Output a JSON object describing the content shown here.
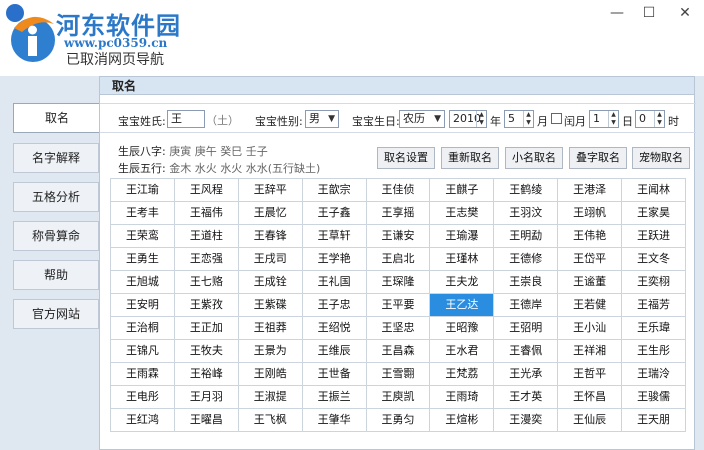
{
  "window": {
    "title": "",
    "minimize": "—",
    "maximize": "☐",
    "close": "✕"
  },
  "watermark": {
    "title": "河东软件园",
    "url": "www.pc0359.cn"
  },
  "status": "已取消网页导航",
  "sidebar": {
    "items": [
      "取名",
      "名字解释",
      "五格分析",
      "称骨算命",
      "帮助",
      "官方网站"
    ]
  },
  "panel": {
    "title": "取名"
  },
  "form": {
    "surname_label": "宝宝姓氏:",
    "surname_value": "王",
    "surname_element": "（土）",
    "gender_label": "宝宝性别:",
    "gender_value": "男",
    "birth_label": "宝宝生日:",
    "calendar_value": "农历",
    "year": "2010",
    "year_unit": "年",
    "month": "5",
    "month_unit": "月",
    "leap_label": "闰月",
    "day": "1",
    "day_unit": "日",
    "hour": "0",
    "hour_unit": "时"
  },
  "bazi": {
    "label": "生辰八字:",
    "value": "庚寅  庚午  癸巳  壬子",
    "wuxing_label": "生辰五行:",
    "wuxing_value": "金木  水火  水火  水水(五行缺土)"
  },
  "actions": [
    "取名设置",
    "重新取名",
    "小名取名",
    "叠字取名",
    "宠物取名"
  ],
  "names": [
    [
      "王江瑜",
      "王风程",
      "王辞平",
      "王歆宗",
      "王佳侦",
      "王麒子",
      "王鹤绫",
      "王港泽",
      "王闻林"
    ],
    [
      "王考丰",
      "王福伟",
      "王晨忆",
      "王子鑫",
      "王享摇",
      "王志樊",
      "王羽汶",
      "王翊帆",
      "王家昊"
    ],
    [
      "王荣鸾",
      "王道柱",
      "王春锋",
      "王草轩",
      "王谦安",
      "王瑜瀑",
      "王明勐",
      "王伟艳",
      "王跃进"
    ],
    [
      "王勇生",
      "王恋强",
      "王戌司",
      "王学艳",
      "王启北",
      "王瑾林",
      "王德修",
      "王岱平",
      "王文冬"
    ],
    [
      "王旭城",
      "王七赂",
      "王成铨",
      "王礼国",
      "王琛隆",
      "王夫龙",
      "王崇良",
      "王谧董",
      "王奕栩"
    ],
    [
      "王安明",
      "王紫孜",
      "王紫碟",
      "王子忠",
      "王平要",
      "王乙达",
      "王德岸",
      "王若健",
      "王福芳"
    ],
    [
      "王治桐",
      "王正加",
      "王祖莽",
      "王绍悦",
      "王坚忠",
      "王昭豫",
      "王弨明",
      "王小汕",
      "王乐瑋"
    ],
    [
      "王锦凡",
      "王牧夫",
      "王景为",
      "王维辰",
      "王昌森",
      "王水君",
      "王睿佩",
      "王祥湘",
      "王生彤"
    ],
    [
      "王雨霖",
      "王裕峰",
      "王刚皓",
      "王世备",
      "王雪翾",
      "王梵荔",
      "王光承",
      "王哲平",
      "王瑞泠"
    ],
    [
      "王电彤",
      "王月羽",
      "王淑提",
      "王振兰",
      "王庾凯",
      "王雨琦",
      "王才英",
      "王怀昌",
      "王骏儒"
    ],
    [
      "王红鸿",
      "王曜昌",
      "王飞枫",
      "王肇华",
      "王勇匀",
      "王煊彬",
      "王漫奕",
      "王仙辰",
      "王天朋"
    ]
  ],
  "selected_name": "王乙达"
}
